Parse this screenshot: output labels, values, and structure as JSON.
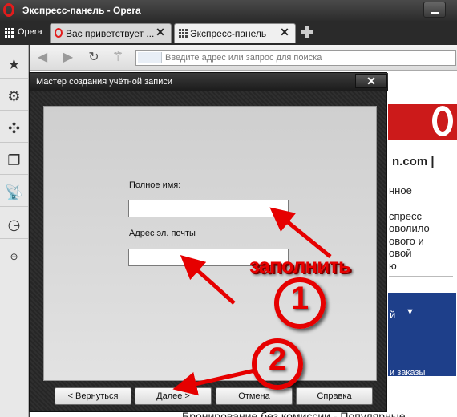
{
  "window": {
    "title": "Экспресс-панель - Opera"
  },
  "tabs": {
    "menu_label": "Opera",
    "items": [
      {
        "label": "Вас приветствует ..."
      },
      {
        "label": "Экспресс-панель"
      }
    ]
  },
  "sidebar": {
    "icons": [
      "star-icon",
      "gear-icon",
      "fan-icon",
      "windows-icon",
      "satellite-icon",
      "clock-icon",
      "plus-icon"
    ]
  },
  "navbar": {
    "address_placeholder": "Введите адрес или запрос для поиска"
  },
  "background_page": {
    "lines": [
      "n.com |",
      "нное",
      "спресс",
      "оволило",
      "ового и",
      "овой",
      "ю",
      "й",
      "и заказы",
      "Бронирование без комиссии - Популярные"
    ]
  },
  "dialog": {
    "title": "Мастер создания учётной записи",
    "full_name_label": "Полное имя:",
    "email_label": "Адрес эл. почты",
    "full_name_value": "",
    "email_value": "",
    "buttons": {
      "back": "< Вернуться",
      "next": "Далее >",
      "cancel": "Отмена",
      "help": "Справка"
    }
  },
  "annotations": {
    "fill_text": "заполнить",
    "step1": "1",
    "step2": "2",
    "color": "#e60000"
  }
}
